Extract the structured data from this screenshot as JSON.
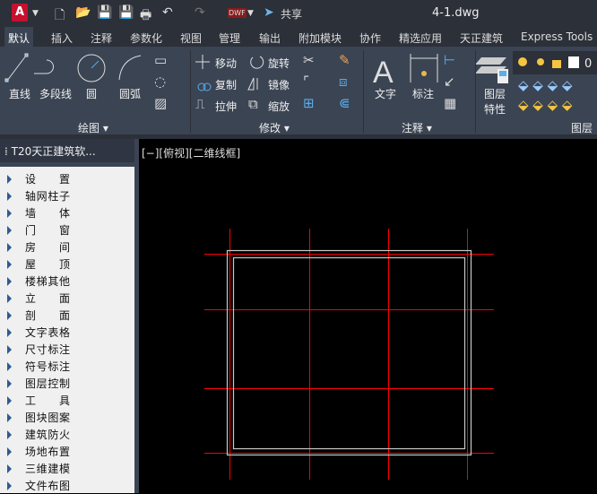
{
  "titlebar": {
    "logo": "A",
    "filename": "4-1.dwg",
    "share": "共享",
    "icons": [
      "new-icon",
      "open-icon",
      "save-icon",
      "save-as-icon",
      "print-icon",
      "undo-icon",
      "redo-icon",
      "dwf-icon",
      "share-icon"
    ]
  },
  "tabs": [
    "默认",
    "插入",
    "注释",
    "参数化",
    "视图",
    "管理",
    "输出",
    "附加模块",
    "协作",
    "精选应用",
    "天正建筑",
    "Express Tools"
  ],
  "ribbon": {
    "draw": {
      "line": "直线",
      "polyline": "多段线",
      "circle": "圆",
      "arc": "圆弧",
      "group": "绘图"
    },
    "modify": {
      "move": "移动",
      "rotate": "旋转",
      "copy": "复制",
      "mirror": "镜像",
      "stretch": "拉伸",
      "scale": "缩放",
      "group": "修改"
    },
    "annotation": {
      "text": "文字",
      "dimension": "标注",
      "group": "注释"
    },
    "layers": {
      "properties_line1": "图层",
      "properties_line2": "特性",
      "current_layer": "0",
      "group": "图层"
    }
  },
  "sidebar": {
    "title": "T20天正建筑软...",
    "items": [
      "设置",
      "轴网柱子",
      "墙体",
      "门窗",
      "房间",
      "屋顶",
      "楼梯其他",
      "立面",
      "剖面",
      "文字表格",
      "尺寸标注",
      "符号标注",
      "图层控制",
      "工具",
      "图块图案",
      "建筑防火",
      "场地布置",
      "三维建模",
      "文件布图"
    ]
  },
  "viewport": {
    "label": "[−][俯视][二维线框]"
  },
  "colors": {
    "axis": "#ff0000",
    "wall": "#c8c8c8",
    "background": "#000000"
  }
}
